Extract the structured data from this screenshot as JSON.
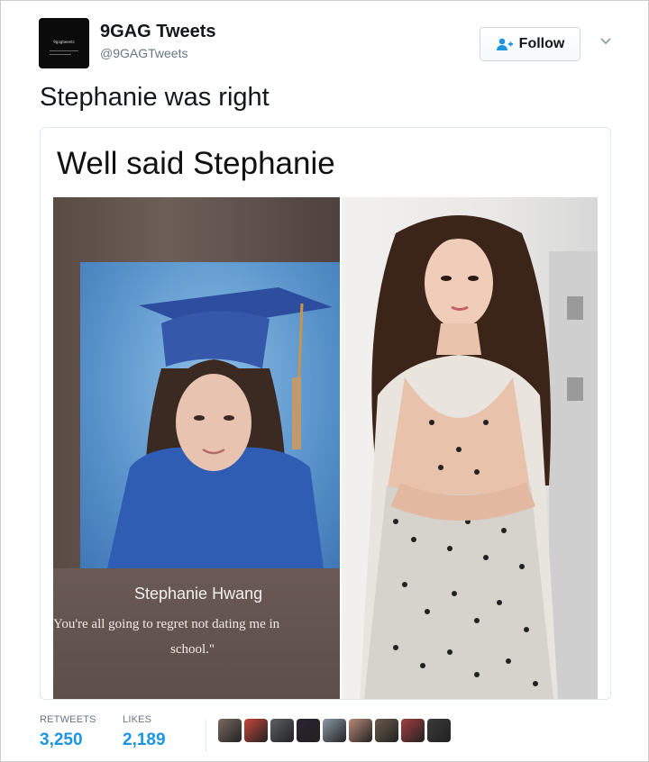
{
  "tweet": {
    "account_name": "9GAG Tweets",
    "account_handle": "@9GAGTweets",
    "avatar_text": "9gagtweets",
    "follow_label": "Follow",
    "text": "Stephanie was right"
  },
  "media": {
    "meme_title": "Well said Stephanie",
    "yearbook_name": "Stephanie Hwang",
    "yearbook_quote_line1": "You're all going to regret not dating me in",
    "yearbook_quote_line2": "school.\""
  },
  "stats": {
    "retweets_label": "RETWEETS",
    "retweets_value": "3,250",
    "likes_label": "LIKES",
    "likes_value": "2,189"
  },
  "likers": [
    {
      "color": "#7b6a60"
    },
    {
      "color": "#c8463a"
    },
    {
      "color": "#5d5f63"
    },
    {
      "color": "#2a2330"
    },
    {
      "color": "#8a9aa8"
    },
    {
      "color": "#b98a78"
    },
    {
      "color": "#6b5a4b"
    },
    {
      "color": "#a33f3f"
    },
    {
      "color": "#3a3a3a"
    }
  ],
  "colors": {
    "link_blue": "#1b95e0",
    "muted_gray": "#657786"
  }
}
